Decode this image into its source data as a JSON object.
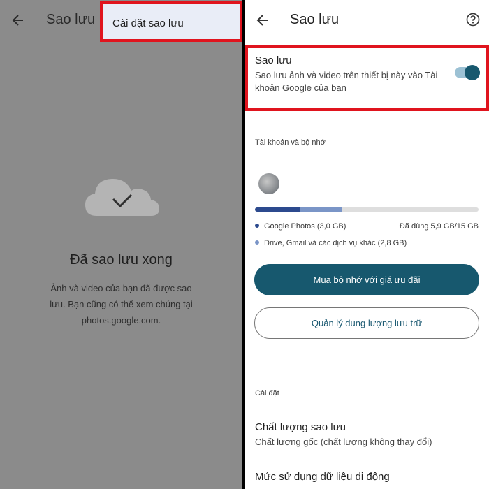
{
  "left": {
    "title": "Sao lưu",
    "menu_item": "Cài đặt sao lưu",
    "heading": "Đã sao lưu xong",
    "body_lines": [
      "Ảnh và video của bạn đã được sao",
      "lưu. Bạn cũng có thể xem chúng tại",
      "photos.google.com."
    ]
  },
  "right": {
    "title": "Sao lưu",
    "backup": {
      "title": "Sao lưu",
      "desc_lines": [
        "Sao lưu ảnh và video trên thiết bị này vào Tài",
        "khoản Google của bạn"
      ],
      "toggle_on": true
    },
    "storage_section": "Tài khoản và bộ nhớ",
    "storage": {
      "photos_fraction": 0.2,
      "other_fraction": 0.187,
      "photos_label": "Google Photos (3,0 GB)",
      "other_label": "Drive, Gmail và các dịch vụ khác (2,8 GB)",
      "used_label": "Đã dùng 5,9 GB/15 GB"
    },
    "buy_button": "Mua bộ nhớ với giá ưu đãi",
    "manage_button": "Quản lý dung lượng lưu trữ",
    "settings_section": "Cài đặt",
    "quality": {
      "title": "Chất lượng sao lưu",
      "subtitle": "Chất lượng gốc (chất lượng không thay đổi)"
    },
    "mobile_data_title": "Mức sử dụng dữ liệu di động"
  },
  "colors": {
    "accent": "#17586e",
    "highlight_border": "#e0141e",
    "photos_bar": "#2c4a8e",
    "other_bar": "#7a95c7",
    "dim_overlay": "#8b8b8b"
  },
  "icons": [
    "back-arrow-icon",
    "cloud-check-icon",
    "help-icon"
  ]
}
